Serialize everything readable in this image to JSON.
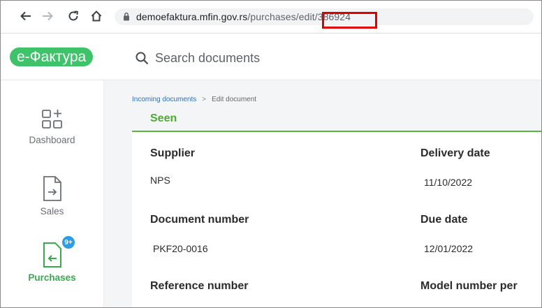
{
  "browser": {
    "url_host": "demoefaktura.mfin.gov.rs",
    "url_path": "/purchases/edit/386924"
  },
  "header": {
    "logo_text": "e-Фактура",
    "search_label": "Search documents"
  },
  "sidebar": {
    "items": [
      {
        "label": "Dashboard",
        "icon": "dashboard-grid-icon"
      },
      {
        "label": "Sales",
        "icon": "sales-document-icon"
      },
      {
        "label": "Purchases",
        "icon": "purchases-document-icon",
        "badge": "9+",
        "active": true
      }
    ]
  },
  "main": {
    "breadcrumb": {
      "link": "Incoming documents",
      "separator": ">",
      "current": "Edit document"
    },
    "status": "Seen",
    "fields": [
      {
        "label": "Supplier",
        "value": "NPS"
      },
      {
        "label": "Delivery date",
        "value": "11/10/2022"
      },
      {
        "label": "Document number",
        "value": "PKF20-0016"
      },
      {
        "label": "Due date",
        "value": "12/01/2022"
      },
      {
        "label": "Reference number",
        "value": ""
      },
      {
        "label": "Model number per",
        "value": ""
      }
    ]
  },
  "colors": {
    "brand_green": "#3ec26a",
    "status_green": "#4faa33",
    "highlight_red": "#e00000",
    "badge_blue": "#2a9de6"
  }
}
